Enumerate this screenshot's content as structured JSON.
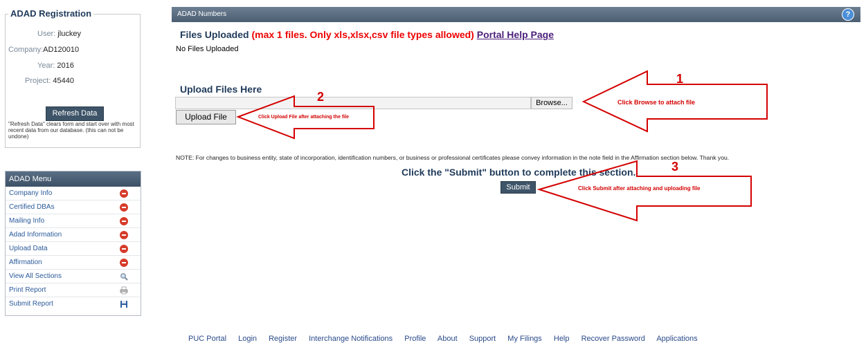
{
  "registration": {
    "legend": "ADAD Registration",
    "user_label": "User:",
    "user_value": "jluckey",
    "company_label": "Company:",
    "company_value": "AD120010",
    "year_label": "Year:",
    "year_value": "2016",
    "project_label": "Project:",
    "project_value": "45440",
    "refresh_label": "Refresh Data",
    "refresh_note": "\"Refresh Data\" clears form and start over with most recent data from our database. (this can not be undone)"
  },
  "menu": {
    "header": "ADAD Menu",
    "items": [
      {
        "label": "Company Info",
        "icon": "minus-circle-icon"
      },
      {
        "label": "Certified DBAs",
        "icon": "minus-circle-icon"
      },
      {
        "label": "Mailing Info",
        "icon": "minus-circle-icon"
      },
      {
        "label": "Adad Information",
        "icon": "minus-circle-icon"
      },
      {
        "label": "Upload Data",
        "icon": "minus-circle-icon"
      },
      {
        "label": "Affirmation",
        "icon": "minus-circle-icon"
      },
      {
        "label": "View All Sections",
        "icon": "magnifier-icon"
      },
      {
        "label": "Print Report",
        "icon": "printer-icon"
      },
      {
        "label": "Submit Report",
        "icon": "floppy-disk-icon"
      }
    ]
  },
  "main": {
    "header": "ADAD Numbers",
    "help_icon": "?",
    "files_title": "Files Uploaded",
    "files_limit": "(max 1 files. Only xls,xlsx,csv file types allowed)",
    "help_link": "Portal Help Page",
    "no_files": "No Files Uploaded",
    "upload_title": "Upload Files Here",
    "browse_label": "Browse...",
    "upload_label": "Upload File",
    "note": "NOTE: For changes to business entity, state of incorporation, identification numbers, or business or professional certificates please convey information in the note field in the Affirmation section below. Thank you.",
    "submit_instruction": "Click the \"Submit\" button to complete this section.",
    "submit_label": "Submit"
  },
  "annotations": {
    "num1": "1",
    "text1": "Click Browse to attach file",
    "num2": "2",
    "text2": "Click Upload File after attaching the file",
    "num3": "3",
    "text3": "Click Submit after attaching and uploading file",
    "color": "#d40000"
  },
  "footer": {
    "links": [
      "PUC Portal",
      "Login",
      "Register",
      "Interchange Notifications",
      "Profile",
      "About",
      "Support",
      "My Filings",
      "Help",
      "Recover Password",
      "Applications"
    ]
  }
}
